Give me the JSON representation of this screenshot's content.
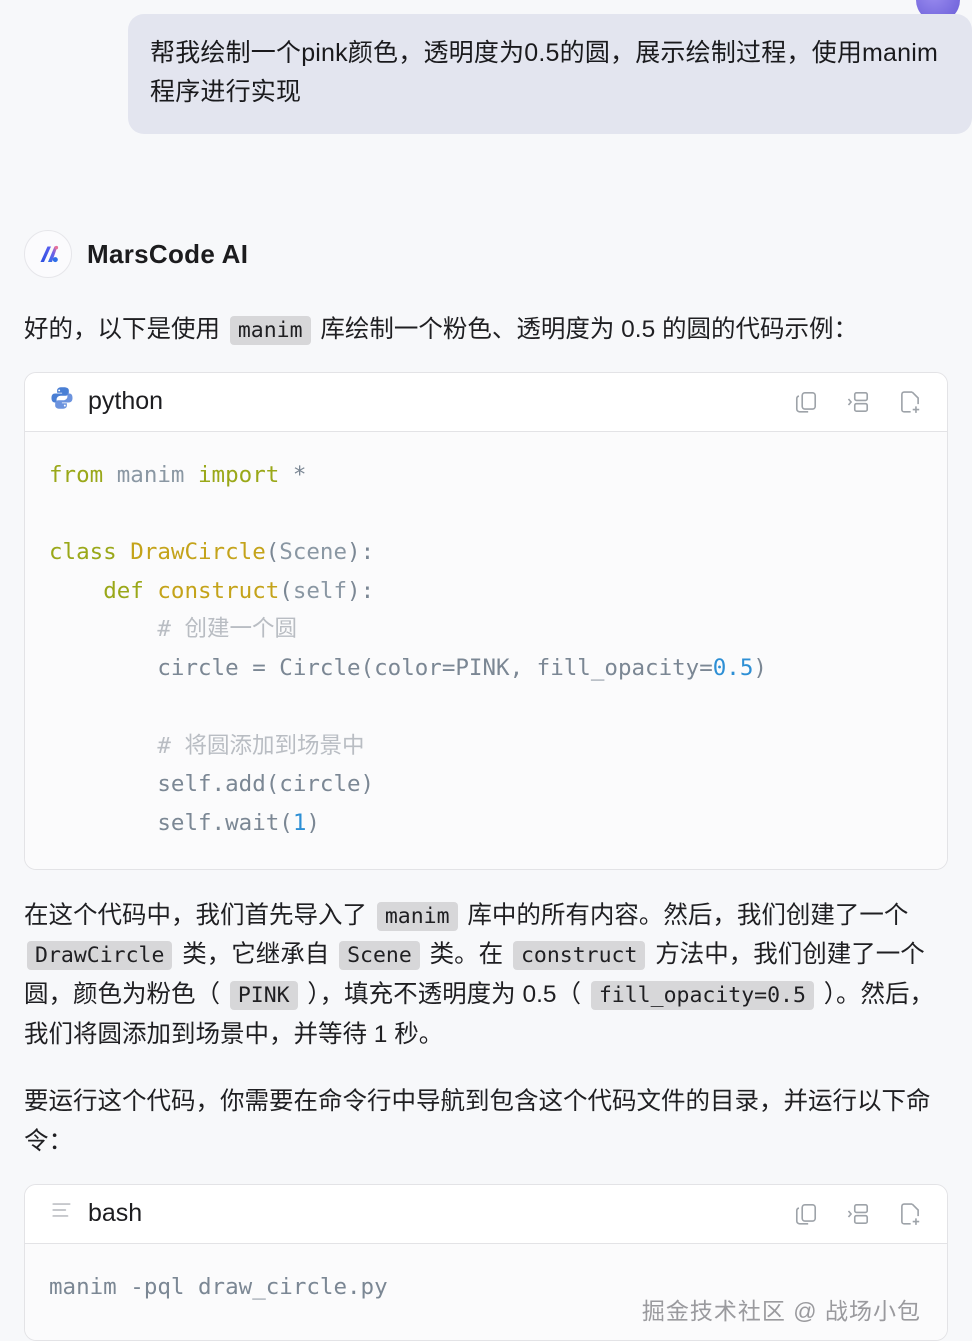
{
  "user_message": {
    "text": "帮我绘制一个pink颜色，透明度为0.5的圆，展示绘制过程，使用manim程序进行实现"
  },
  "assistant": {
    "name": "MarsCode AI",
    "avatar_icon": "marscode-logo-icon",
    "intro": {
      "part1": "好的，以下是使用",
      "chip1": "manim",
      "part2": "库绘制一个粉色、透明度为 0.5 的圆的代码示例："
    },
    "explanation": {
      "s1": "在这个代码中，我们首先导入了",
      "c1": "manim",
      "s2": "库中的所有内容。然后，我们创建了一个",
      "c2": "DrawCircle",
      "s3": "类，它继承自",
      "c3": "Scene",
      "s4": "类。在",
      "c4": "construct",
      "s5": "方法中，我们创建了一个圆，颜色为粉色（",
      "c5": "PINK",
      "s6": "），填充不透明度为 0.5（",
      "c6": "fill_opacity=0.5",
      "s7": "）。然后，我们将圆添加到场景中，并等待 1 秒。"
    },
    "run_instruction": "要运行这个代码，你需要在命令行中导航到包含这个代码文件的目录，并运行以下命令："
  },
  "code_blocks": [
    {
      "language": "python",
      "lang_icon": "python-icon",
      "actions": [
        "copy-icon",
        "insert-code-icon",
        "new-file-icon"
      ],
      "lines": [
        [
          {
            "t": "from ",
            "c": "kw"
          },
          {
            "t": "manim ",
            "c": "par"
          },
          {
            "t": "import ",
            "c": "kw"
          },
          {
            "t": "*",
            "c": "op"
          }
        ],
        [],
        [
          {
            "t": "class ",
            "c": "kw"
          },
          {
            "t": "DrawCircle",
            "c": "cls"
          },
          {
            "t": "(",
            "c": "op"
          },
          {
            "t": "Scene",
            "c": "par"
          },
          {
            "t": "):",
            "c": "op"
          }
        ],
        [
          {
            "t": "    ",
            "c": "op"
          },
          {
            "t": "def ",
            "c": "kw"
          },
          {
            "t": "construct",
            "c": "fn"
          },
          {
            "t": "(",
            "c": "op"
          },
          {
            "t": "self",
            "c": "par"
          },
          {
            "t": "):",
            "c": "op"
          }
        ],
        [
          {
            "t": "        ",
            "c": "op"
          },
          {
            "t": "# 创建一个圆",
            "c": "com"
          }
        ],
        [
          {
            "t": "        circle = Circle(color=PINK, fill_opacity=",
            "c": "op"
          },
          {
            "t": "0.5",
            "c": "num"
          },
          {
            "t": ")",
            "c": "op"
          }
        ],
        [],
        [
          {
            "t": "        ",
            "c": "op"
          },
          {
            "t": "# 将圆添加到场景中",
            "c": "com"
          }
        ],
        [
          {
            "t": "        self.add(circle)",
            "c": "op"
          }
        ],
        [
          {
            "t": "        self.wait(",
            "c": "op"
          },
          {
            "t": "1",
            "c": "num"
          },
          {
            "t": ")",
            "c": "op"
          }
        ]
      ]
    },
    {
      "language": "bash",
      "lang_icon": "terminal-lines-icon",
      "actions": [
        "copy-icon",
        "insert-code-icon",
        "new-file-icon"
      ],
      "lines": [
        [
          {
            "t": "manim -pql draw_circle.py",
            "c": "op"
          }
        ]
      ]
    }
  ],
  "watermark": "掘金技术社区 @ 战场小包",
  "colors": {
    "page_bg": "#f7f8fa",
    "user_bubble_bg": "#e3e5ef",
    "chip_bg": "#d7d7d9",
    "accent_blue": "#3a6ff0",
    "number_blue": "#2d8fd5",
    "keyword_olive": "#9aa819",
    "function_gold": "#c4a31a",
    "comment_gray": "#b9bdc3"
  }
}
